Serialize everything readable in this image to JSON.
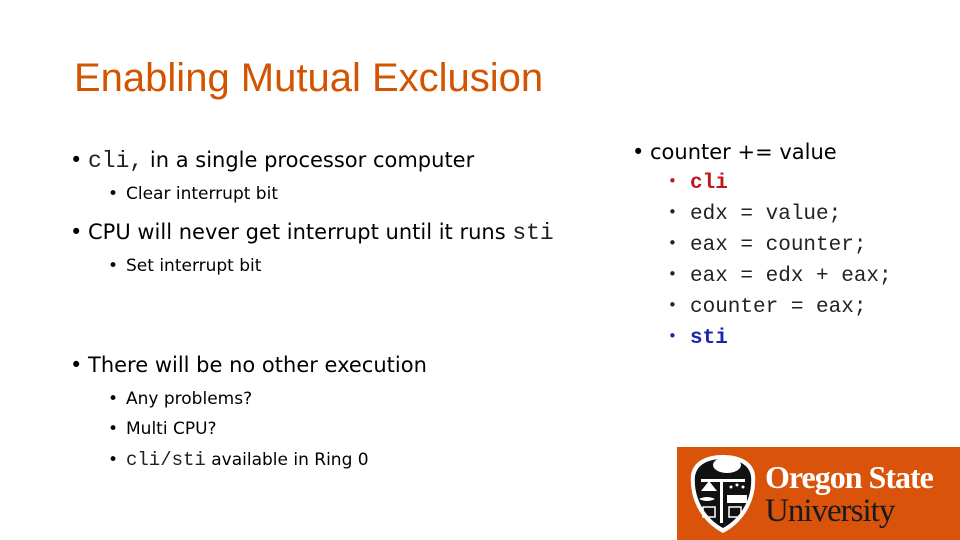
{
  "slide": {
    "title": "Enabling Mutual Exclusion",
    "left_column": {
      "items": [
        {
          "code": "cli,",
          "text": " in a single processor computer",
          "sub": [
            {
              "text": "Clear interrupt bit"
            }
          ]
        },
        {
          "text": "CPU will never get interrupt until it runs ",
          "code": "sti",
          "sub": [
            {
              "text": "Set interrupt bit"
            }
          ]
        },
        {
          "text": "There will be no other execution",
          "sub": [
            {
              "text": "Any problems?"
            },
            {
              "text": "Multi CPU?"
            },
            {
              "code": "cli/sti",
              "text": " available in Ring 0"
            }
          ]
        }
      ]
    },
    "right_column": {
      "heading": "counter += value",
      "code_lines": [
        {
          "text": "cli",
          "color": "#c0181a"
        },
        {
          "text": "edx = value;",
          "color": "#222222"
        },
        {
          "text": "eax = counter;",
          "color": "#222222"
        },
        {
          "text": "eax = edx + eax;",
          "color": "#222222"
        },
        {
          "text": "counter = eax;",
          "color": "#222222"
        },
        {
          "text": "sti",
          "color": "#1a27a8"
        }
      ]
    },
    "logo": {
      "line1": "Oregon State",
      "line2": "University",
      "background": "#d9530b"
    },
    "colors": {
      "title": "#d35400",
      "bullet_bg": "#ffffff"
    },
    "bullet": "•"
  }
}
